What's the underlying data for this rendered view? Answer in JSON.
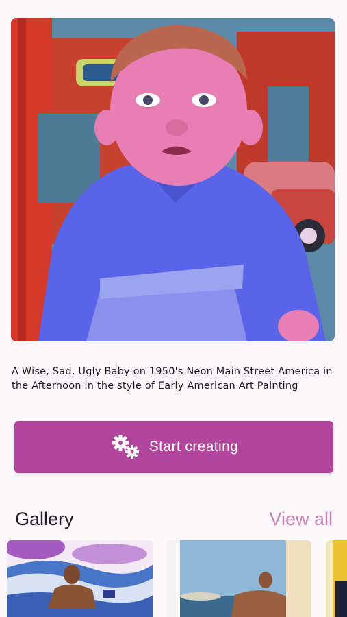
{
  "hero": {
    "image_alt": "Painting of a sad baby in a blue shirt on a neon main street"
  },
  "prompt": {
    "text": "A Wise, Sad, Ugly Baby on 1950's Neon Main Street America in the Afternoon in the style of Early American Art Painting"
  },
  "cta": {
    "label": "Start creating",
    "icon": "gears-icon",
    "color": "#b2459c"
  },
  "gallery": {
    "title": "Gallery",
    "view_all_label": "View all",
    "view_all_color": "#c97fb6"
  },
  "colors": {
    "background": "#fcf8fc",
    "accent": "#b2459c"
  }
}
